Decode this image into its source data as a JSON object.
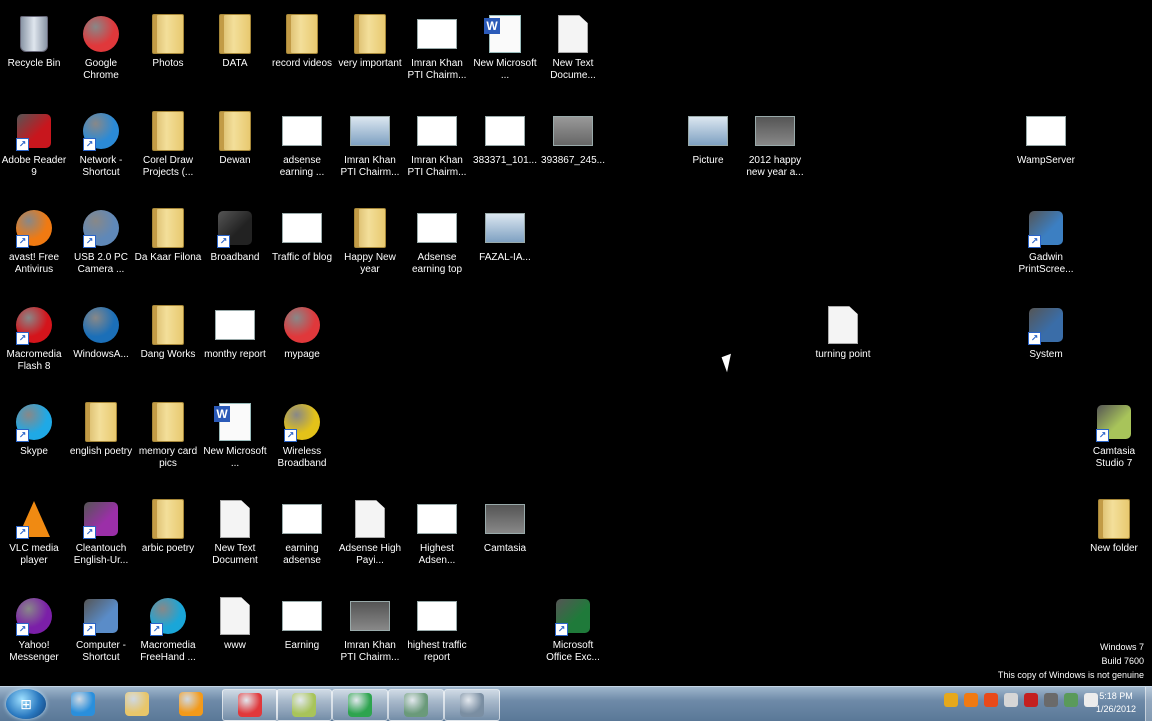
{
  "desktop": {
    "icons": [
      {
        "label": "Recycle Bin",
        "icon": "recycle-bin-icon",
        "type": "bin",
        "shortcut": false
      },
      {
        "label": "Google Chrome",
        "icon": "chrome-icon",
        "type": "round",
        "color": "#e0383b",
        "shortcut": false
      },
      {
        "label": "Photos",
        "icon": "folder-icon",
        "type": "folder",
        "shortcut": false
      },
      {
        "label": "DATA",
        "icon": "folder-icon",
        "type": "folder",
        "shortcut": false
      },
      {
        "label": "record videos",
        "icon": "folder-icon",
        "type": "folder",
        "shortcut": false
      },
      {
        "label": "very important",
        "icon": "folder-icon",
        "type": "folder",
        "shortcut": false
      },
      {
        "label": "Imran Khan PTI Chairm...",
        "icon": "image-thumbnail-icon",
        "type": "thumb-white",
        "shortcut": false
      },
      {
        "label": "New Microsoft ...",
        "icon": "word-document-icon",
        "type": "word",
        "shortcut": false
      },
      {
        "label": "New Text Docume...",
        "icon": "text-document-icon",
        "type": "doc",
        "shortcut": false
      },
      {
        "label": "Adobe Reader 9",
        "icon": "adobe-reader-icon",
        "type": "square",
        "color": "#c8161d",
        "shortcut": true
      },
      {
        "label": "Network - Shortcut",
        "icon": "network-globe-icon",
        "type": "round",
        "color": "#2b8ad6",
        "shortcut": true
      },
      {
        "label": "Corel Draw Projects (...",
        "icon": "folder-icon",
        "type": "folder",
        "shortcut": false
      },
      {
        "label": "Dewan",
        "icon": "folder-icon",
        "type": "folder",
        "shortcut": false
      },
      {
        "label": "adsense earning ...",
        "icon": "image-thumbnail-icon",
        "type": "thumb-white",
        "shortcut": false
      },
      {
        "label": "Imran Khan PTI Chairm...",
        "icon": "image-thumbnail-icon",
        "type": "thumb-blue",
        "shortcut": false
      },
      {
        "label": "Imran Khan PTI Chairm...",
        "icon": "image-thumbnail-icon",
        "type": "thumb-white",
        "shortcut": false
      },
      {
        "label": "383371_101...",
        "icon": "image-thumbnail-icon",
        "type": "thumb-white",
        "shortcut": false
      },
      {
        "label": "393867_245...",
        "icon": "image-thumbnail-icon",
        "type": "thumb-gray",
        "shortcut": false
      },
      {
        "label": "Picture",
        "icon": "image-thumbnail-icon",
        "type": "thumb-blue",
        "shortcut": false
      },
      {
        "label": "2012 happy new year a...",
        "icon": "image-thumbnail-icon",
        "type": "thumb-dark",
        "shortcut": false
      },
      {
        "label": "WampServer",
        "icon": "wampserver-icon",
        "type": "thumb-white",
        "shortcut": false
      },
      {
        "label": "avast! Free Antivirus",
        "icon": "avast-icon",
        "type": "round",
        "color": "#f07a12",
        "shortcut": true
      },
      {
        "label": "USB 2.0 PC Camera ...",
        "icon": "webcam-icon",
        "type": "round",
        "color": "#5f88b8",
        "shortcut": true
      },
      {
        "label": "Da Kaar Filona",
        "icon": "folder-icon",
        "type": "folder",
        "shortcut": false
      },
      {
        "label": "Broadband",
        "icon": "evo-broadband-icon",
        "type": "square",
        "color": "#222222",
        "shortcut": true
      },
      {
        "label": "Traffic of blog",
        "icon": "image-thumbnail-icon",
        "type": "thumb-white",
        "shortcut": false
      },
      {
        "label": "Happy New year",
        "icon": "folder-icon",
        "type": "folder",
        "shortcut": false
      },
      {
        "label": "Adsense earning top",
        "icon": "image-thumbnail-icon",
        "type": "thumb-white",
        "shortcut": false
      },
      {
        "label": "FAZAL-IA...",
        "icon": "image-thumbnail-icon",
        "type": "thumb-blue",
        "shortcut": false
      },
      {
        "label": "Gadwin PrintScree...",
        "icon": "gadwin-printscreen-icon",
        "type": "square",
        "color": "#3c7fc2",
        "shortcut": true
      },
      {
        "label": "Macromedia Flash 8",
        "icon": "flash-icon",
        "type": "round",
        "color": "#d4141b",
        "shortcut": true
      },
      {
        "label": "WindowsA...",
        "icon": "windows-star-icon",
        "type": "round",
        "color": "#1b6fb8",
        "shortcut": false
      },
      {
        "label": "Dang Works",
        "icon": "folder-icon",
        "type": "folder",
        "shortcut": false
      },
      {
        "label": "monthy report",
        "icon": "image-thumbnail-icon",
        "type": "thumb-white",
        "shortcut": false
      },
      {
        "label": "mypage",
        "icon": "chrome-icon",
        "type": "round",
        "color": "#e0383b",
        "shortcut": false
      },
      {
        "label": "turning point",
        "icon": "text-document-icon",
        "type": "doc",
        "shortcut": false
      },
      {
        "label": "System",
        "icon": "laptop-icon",
        "type": "square",
        "color": "#3a6da8",
        "shortcut": true
      },
      {
        "label": "Skype",
        "icon": "skype-icon",
        "type": "round",
        "color": "#1fa9e6",
        "shortcut": true
      },
      {
        "label": "english poetry",
        "icon": "folder-icon",
        "type": "folder",
        "shortcut": false
      },
      {
        "label": "memory card pics",
        "icon": "folder-icon",
        "type": "folder",
        "shortcut": false
      },
      {
        "label": "New Microsoft ...",
        "icon": "word-document-icon",
        "type": "word",
        "shortcut": false
      },
      {
        "label": "Wireless Broadband",
        "icon": "wireless-broadband-icon",
        "type": "round",
        "color": "#e3c219",
        "shortcut": true
      },
      {
        "label": "Camtasia Studio 7",
        "icon": "camtasia-studio-icon",
        "type": "square",
        "color": "#a8c45a",
        "shortcut": true
      },
      {
        "label": "VLC media player",
        "icon": "vlc-icon",
        "type": "cone",
        "color": "#f08a12",
        "shortcut": true
      },
      {
        "label": "Cleantouch English-Ur...",
        "icon": "books-icon",
        "type": "square",
        "color": "#9b2fa8",
        "shortcut": true
      },
      {
        "label": "arbic poetry",
        "icon": "folder-icon",
        "type": "folder",
        "shortcut": false
      },
      {
        "label": "New Text Document",
        "icon": "text-document-icon",
        "type": "doc",
        "shortcut": false
      },
      {
        "label": "earning adsense",
        "icon": "image-thumbnail-icon",
        "type": "thumb-white",
        "shortcut": false
      },
      {
        "label": "Adsense High Payi...",
        "icon": "magnifier-document-icon",
        "type": "doc",
        "shortcut": false
      },
      {
        "label": "Highest Adsen...",
        "icon": "image-thumbnail-icon",
        "type": "thumb-white",
        "shortcut": false
      },
      {
        "label": "Camtasia",
        "icon": "camtasia-icon",
        "type": "thumb-dark",
        "shortcut": false
      },
      {
        "label": "New folder",
        "icon": "folder-icon",
        "type": "folder",
        "shortcut": false
      },
      {
        "label": "Yahoo! Messenger",
        "icon": "yahoo-messenger-icon",
        "type": "round",
        "color": "#7b1fa8",
        "shortcut": true
      },
      {
        "label": "Computer - Shortcut",
        "icon": "computer-icon",
        "type": "square",
        "color": "#5a8cc8",
        "shortcut": true
      },
      {
        "label": "Macromedia FreeHand ...",
        "icon": "freehand-icon",
        "type": "round",
        "color": "#1aa6d8",
        "shortcut": true
      },
      {
        "label": "www",
        "icon": "text-document-icon",
        "type": "doc",
        "shortcut": false
      },
      {
        "label": "Earning",
        "icon": "image-thumbnail-icon",
        "type": "thumb-white",
        "shortcut": false
      },
      {
        "label": "Imran Khan PTI Chairm...",
        "icon": "image-thumbnail-icon",
        "type": "thumb-dark",
        "shortcut": false
      },
      {
        "label": "highest traffic report",
        "icon": "image-thumbnail-icon",
        "type": "thumb-white",
        "shortcut": false
      },
      {
        "label": "Microsoft Office Exc...",
        "icon": "excel-icon",
        "type": "square",
        "color": "#1f7a3a",
        "shortcut": true
      }
    ]
  },
  "watermark": {
    "line1": "Windows 7",
    "line2": "Build 7600",
    "line3": "This copy of Windows is not genuine"
  },
  "taskbar": {
    "start_icon": "windows-start-orb-icon",
    "pinned": [
      {
        "icon": "internet-explorer-icon",
        "color": "#2a8fdc",
        "active": false
      },
      {
        "icon": "windows-explorer-icon",
        "color": "#e8c66a",
        "active": false
      },
      {
        "icon": "media-player-icon",
        "color": "#f39a1a",
        "active": false
      },
      {
        "icon": "chrome-icon",
        "color": "#e0383b",
        "active": true
      },
      {
        "icon": "camtasia-studio-icon",
        "color": "#a8c45a",
        "active": true
      },
      {
        "icon": "camtasia-recorder-icon",
        "color": "#2ea44f",
        "active": true
      },
      {
        "icon": "image-viewer-icon",
        "color": "#6a9a7a",
        "active": true
      },
      {
        "icon": "paint-icon",
        "color": "#7a8ea2",
        "active": true
      }
    ],
    "tray_icons": [
      {
        "icon": "network-tray-icon",
        "color": "#e6a81c"
      },
      {
        "icon": "avast-tray-icon",
        "color": "#f07a12"
      },
      {
        "icon": "yahoo-tray-icon",
        "color": "#e84a1a"
      },
      {
        "icon": "safely-remove-tray-icon",
        "color": "#d6d6d6"
      },
      {
        "icon": "action-center-tray-icon",
        "color": "#c42020"
      },
      {
        "icon": "broadband-tray-icon",
        "color": "#6a6a6a"
      },
      {
        "icon": "camtasia-tray-icon",
        "color": "#5a9a5a"
      },
      {
        "icon": "volume-tray-icon",
        "color": "#ececec"
      }
    ],
    "clock": {
      "time": "5:18 PM",
      "date": "1/26/2012"
    }
  }
}
